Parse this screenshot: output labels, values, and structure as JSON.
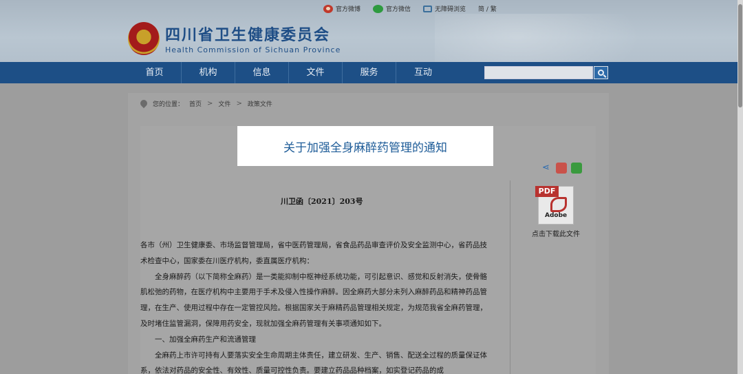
{
  "toplinks": {
    "weibo": "官方微博",
    "wechat": "官方微信",
    "accessibility": "无障碍浏览",
    "lang": "简 / 繁"
  },
  "logo": {
    "cn": "四川省卫生健康委员会",
    "en": "Health Commission of Sichuan Province"
  },
  "nav": {
    "items": [
      "首页",
      "机构",
      "信息",
      "文件",
      "服务",
      "互动"
    ],
    "search_placeholder": ""
  },
  "breadcrumb": {
    "prefix": "您的位置：",
    "items": [
      "首页",
      "文件",
      "政策文件"
    ],
    "sep": ">"
  },
  "article": {
    "title": "关于加强全身麻醉药管理的通知",
    "doc_no": "川卫函〔2021〕203号",
    "paragraphs": [
      "各市（州）卫生健康委、市场监督管理局，省中医药管理局，省食品药品审查评价及安全监测中心，省药品技术检查中心，国家委在川医疗机构，委直属医疗机构：",
      "全身麻醉药（以下简称全麻药）是一类能抑制中枢神经系统功能，可引起意识、感觉和反射消失，使骨骼肌松弛的药物，在医疗机构中主要用于手术及侵入性操作麻醉。因全麻药大部分未列入麻醉药品和精神药品管理，在生产、使用过程中存在一定管控风险。根据国家关于麻精药品管理相关规定，为规范我省全麻药管理，及时堵住监管漏洞，保障用药安全，现就加强全麻药管理有关事项通知如下。",
      "一、加强全麻药生产和流通管理",
      "全麻药上市许可持有人要落实安全生命周期主体责任，建立研发、生产、销售、配送全过程的质量保证体系，依法对药品的安全性、有效性、质量可控性负责。要建立药品品种档案，如实登记药品的成"
    ]
  },
  "download": {
    "pdf_tag": "PDF",
    "adobe": "Adobe",
    "label": "点击下载此文件"
  },
  "share": {
    "share_icon": "share-icon",
    "weibo_icon": "weibo-icon",
    "wechat_icon": "wechat-icon"
  }
}
